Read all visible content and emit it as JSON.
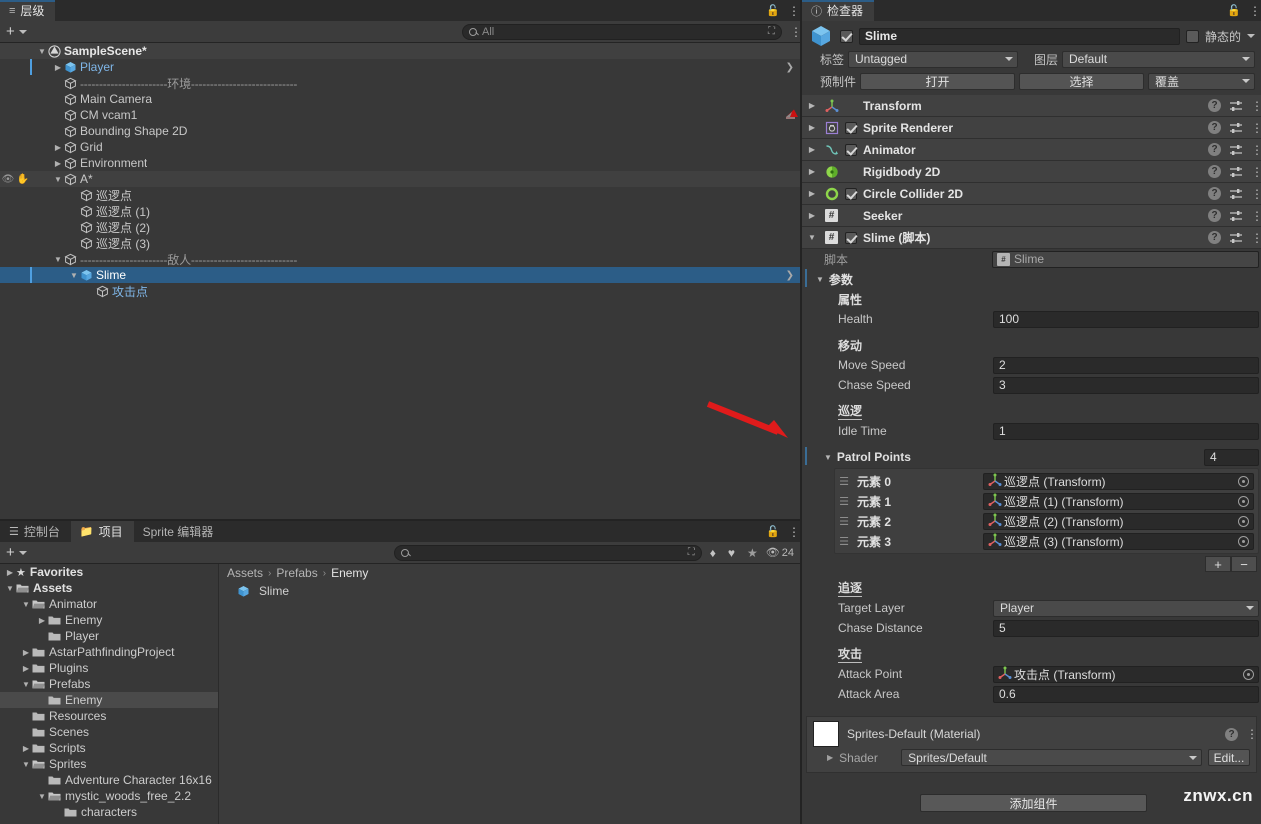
{
  "hierarchy": {
    "tab_label": "层级",
    "tab_icon": "hierarchy-icon",
    "search_placeholder": "All",
    "rows": [
      {
        "label": "SampleScene*",
        "depth": 1,
        "twisty": "open",
        "icon": "unity-scene",
        "style": "scene"
      },
      {
        "label": "Player",
        "depth": 2,
        "twisty": "closed",
        "icon": "prefab-cube",
        "style": "prefab"
      },
      {
        "label": "-----------------------环境----------------------------",
        "depth": 2,
        "twisty": "none",
        "icon": "gameobject-cube",
        "style": "separator"
      },
      {
        "label": "Main Camera",
        "depth": 2,
        "twisty": "none",
        "icon": "gameobject-cube",
        "style": "normal"
      },
      {
        "label": "CM vcam1",
        "depth": 2,
        "twisty": "none",
        "icon": "gameobject-cube",
        "style": "normal"
      },
      {
        "label": "Bounding Shape 2D",
        "depth": 2,
        "twisty": "none",
        "icon": "gameobject-cube",
        "style": "normal"
      },
      {
        "label": "Grid",
        "depth": 2,
        "twisty": "closed",
        "icon": "gameobject-cube",
        "style": "normal"
      },
      {
        "label": "Environment",
        "depth": 2,
        "twisty": "closed",
        "icon": "gameobject-cube",
        "style": "normal"
      },
      {
        "label": "A*",
        "depth": 2,
        "twisty": "open",
        "icon": "gameobject-cube",
        "style": "hover"
      },
      {
        "label": "巡逻点",
        "depth": 3,
        "twisty": "none",
        "icon": "gameobject-cube",
        "style": "normal"
      },
      {
        "label": "巡逻点 (1)",
        "depth": 3,
        "twisty": "none",
        "icon": "gameobject-cube",
        "style": "normal"
      },
      {
        "label": "巡逻点 (2)",
        "depth": 3,
        "twisty": "none",
        "icon": "gameobject-cube",
        "style": "normal"
      },
      {
        "label": "巡逻点 (3)",
        "depth": 3,
        "twisty": "none",
        "icon": "gameobject-cube",
        "style": "normal"
      },
      {
        "label": "-----------------------敌人----------------------------",
        "depth": 2,
        "twisty": "open",
        "icon": "gameobject-cube",
        "style": "separator"
      },
      {
        "label": "Slime",
        "depth": 3,
        "twisty": "open",
        "icon": "prefab-cube",
        "style": "selected"
      },
      {
        "label": "攻击点",
        "depth": 4,
        "twisty": "none",
        "icon": "gameobject-cube",
        "style": "child-blue"
      }
    ]
  },
  "project": {
    "tabs": [
      {
        "label": "控制台",
        "icon": "console-icon",
        "active": false
      },
      {
        "label": "项目",
        "icon": "folder-icon",
        "active": true
      },
      {
        "label": "Sprite 编辑器",
        "icon": "none",
        "active": false
      }
    ],
    "search_placeholder": "",
    "filter_icons": [
      "asset-type-filter-icon",
      "label-filter-icon",
      "favorite-star-icon"
    ],
    "hidden_count": "24",
    "breadcrumb": [
      "Assets",
      "Prefabs",
      "Enemy"
    ],
    "content_items": [
      {
        "label": "Slime",
        "icon": "prefab-cube"
      }
    ],
    "tree": [
      {
        "label": "Favorites",
        "depth": 0,
        "twisty": "closed",
        "icon": "star-icon",
        "bold": true
      },
      {
        "label": "Assets",
        "depth": 0,
        "twisty": "open",
        "icon": "folder-open",
        "bold": true
      },
      {
        "label": "Animator",
        "depth": 1,
        "twisty": "open",
        "icon": "folder-open",
        "bold": false
      },
      {
        "label": "Enemy",
        "depth": 2,
        "twisty": "closed",
        "icon": "folder",
        "bold": false
      },
      {
        "label": "Player",
        "depth": 2,
        "twisty": "none",
        "icon": "folder",
        "bold": false
      },
      {
        "label": "AstarPathfindingProject",
        "depth": 1,
        "twisty": "closed",
        "icon": "folder",
        "bold": false
      },
      {
        "label": "Plugins",
        "depth": 1,
        "twisty": "closed",
        "icon": "folder",
        "bold": false
      },
      {
        "label": "Prefabs",
        "depth": 1,
        "twisty": "open",
        "icon": "folder-open",
        "bold": false
      },
      {
        "label": "Enemy",
        "depth": 2,
        "twisty": "none",
        "icon": "folder",
        "bold": false,
        "selected": true
      },
      {
        "label": "Resources",
        "depth": 1,
        "twisty": "none",
        "icon": "folder",
        "bold": false
      },
      {
        "label": "Scenes",
        "depth": 1,
        "twisty": "none",
        "icon": "folder",
        "bold": false
      },
      {
        "label": "Scripts",
        "depth": 1,
        "twisty": "closed",
        "icon": "folder",
        "bold": false
      },
      {
        "label": "Sprites",
        "depth": 1,
        "twisty": "open",
        "icon": "folder-open",
        "bold": false
      },
      {
        "label": "Adventure Character 16x16",
        "depth": 2,
        "twisty": "none",
        "icon": "folder",
        "bold": false
      },
      {
        "label": "mystic_woods_free_2.2",
        "depth": 2,
        "twisty": "open",
        "icon": "folder-open",
        "bold": false
      },
      {
        "label": "characters",
        "depth": 3,
        "twisty": "none",
        "icon": "folder",
        "bold": false
      }
    ]
  },
  "inspector": {
    "tab_label": "检查器",
    "tab_icon": "info-icon",
    "object_name": "Slime",
    "enabled": true,
    "static_label": "静态的",
    "tag_label": "标签",
    "tag_value": "Untagged",
    "layer_label": "图层",
    "layer_value": "Default",
    "prefab_label": "预制件",
    "prefab_open": "打开",
    "prefab_select": "选择",
    "prefab_overrides": "覆盖",
    "components": [
      {
        "name": "Transform",
        "icon": "transform-icon",
        "has_checkbox": false,
        "expanded": false
      },
      {
        "name": "Sprite Renderer",
        "icon": "sprite-renderer-icon",
        "has_checkbox": true,
        "checked": true,
        "expanded": false
      },
      {
        "name": "Animator",
        "icon": "animator-icon",
        "has_checkbox": true,
        "checked": true,
        "expanded": false
      },
      {
        "name": "Rigidbody 2D",
        "icon": "rigidbody2d-icon",
        "has_checkbox": false,
        "expanded": false
      },
      {
        "name": "Circle Collider 2D",
        "icon": "circle-collider-icon",
        "has_checkbox": true,
        "checked": true,
        "expanded": false
      },
      {
        "name": "Seeker",
        "icon": "script-icon",
        "has_checkbox": false,
        "expanded": false
      },
      {
        "name": "Slime  (脚本)",
        "icon": "script-icon",
        "has_checkbox": true,
        "checked": true,
        "expanded": true
      }
    ],
    "script_row": {
      "label": "脚本",
      "value": "Slime"
    },
    "params_header": "参数",
    "groups": [
      {
        "title": "属性",
        "fields": [
          {
            "label": "Health",
            "value": "100",
            "type": "number"
          }
        ]
      },
      {
        "title": "移动",
        "fields": [
          {
            "label": "Move Speed",
            "value": "2",
            "type": "number"
          },
          {
            "label": "Chase Speed",
            "value": "3",
            "type": "number"
          }
        ]
      },
      {
        "title": "巡逻",
        "underline": true,
        "fields": [
          {
            "label": "Idle Time",
            "value": "1",
            "type": "number"
          }
        ]
      }
    ],
    "patrol_points": {
      "label": "Patrol Points",
      "size": "4",
      "elements": [
        {
          "label": "元素 0",
          "value": "巡逻点 (Transform)"
        },
        {
          "label": "元素 1",
          "value": "巡逻点 (1) (Transform)"
        },
        {
          "label": "元素 2",
          "value": "巡逻点 (2) (Transform)"
        },
        {
          "label": "元素 3",
          "value": "巡逻点 (3) (Transform)"
        }
      ],
      "add_label": "+",
      "remove_label": "−"
    },
    "groups2": [
      {
        "title": "追逐",
        "underline": true,
        "fields": [
          {
            "label": "Target Layer",
            "value": "Player",
            "type": "dropdown"
          },
          {
            "label": "Chase Distance",
            "value": "5",
            "type": "number"
          }
        ]
      },
      {
        "title": "攻击",
        "underline": true,
        "fields": [
          {
            "label": "Attack Point",
            "value": "攻击点 (Transform)",
            "type": "object"
          },
          {
            "label": "Attack Area",
            "value": "0.6",
            "type": "number"
          }
        ]
      }
    ],
    "material": {
      "title": "Sprites-Default (Material)",
      "shader_label": "Shader",
      "shader_value": "Sprites/Default",
      "edit_label": "Edit..."
    },
    "add_component_label": "添加组件"
  },
  "watermark": "znwx.cn",
  "colors": {
    "panel_bg": "#383838",
    "tab_bg": "#2b2b2b",
    "selected_blue": "#2c5d87",
    "accent_blue": "#4f9fe0",
    "prefab_blue": "#7fb6e8",
    "annotation_red": "#e01b1b"
  }
}
